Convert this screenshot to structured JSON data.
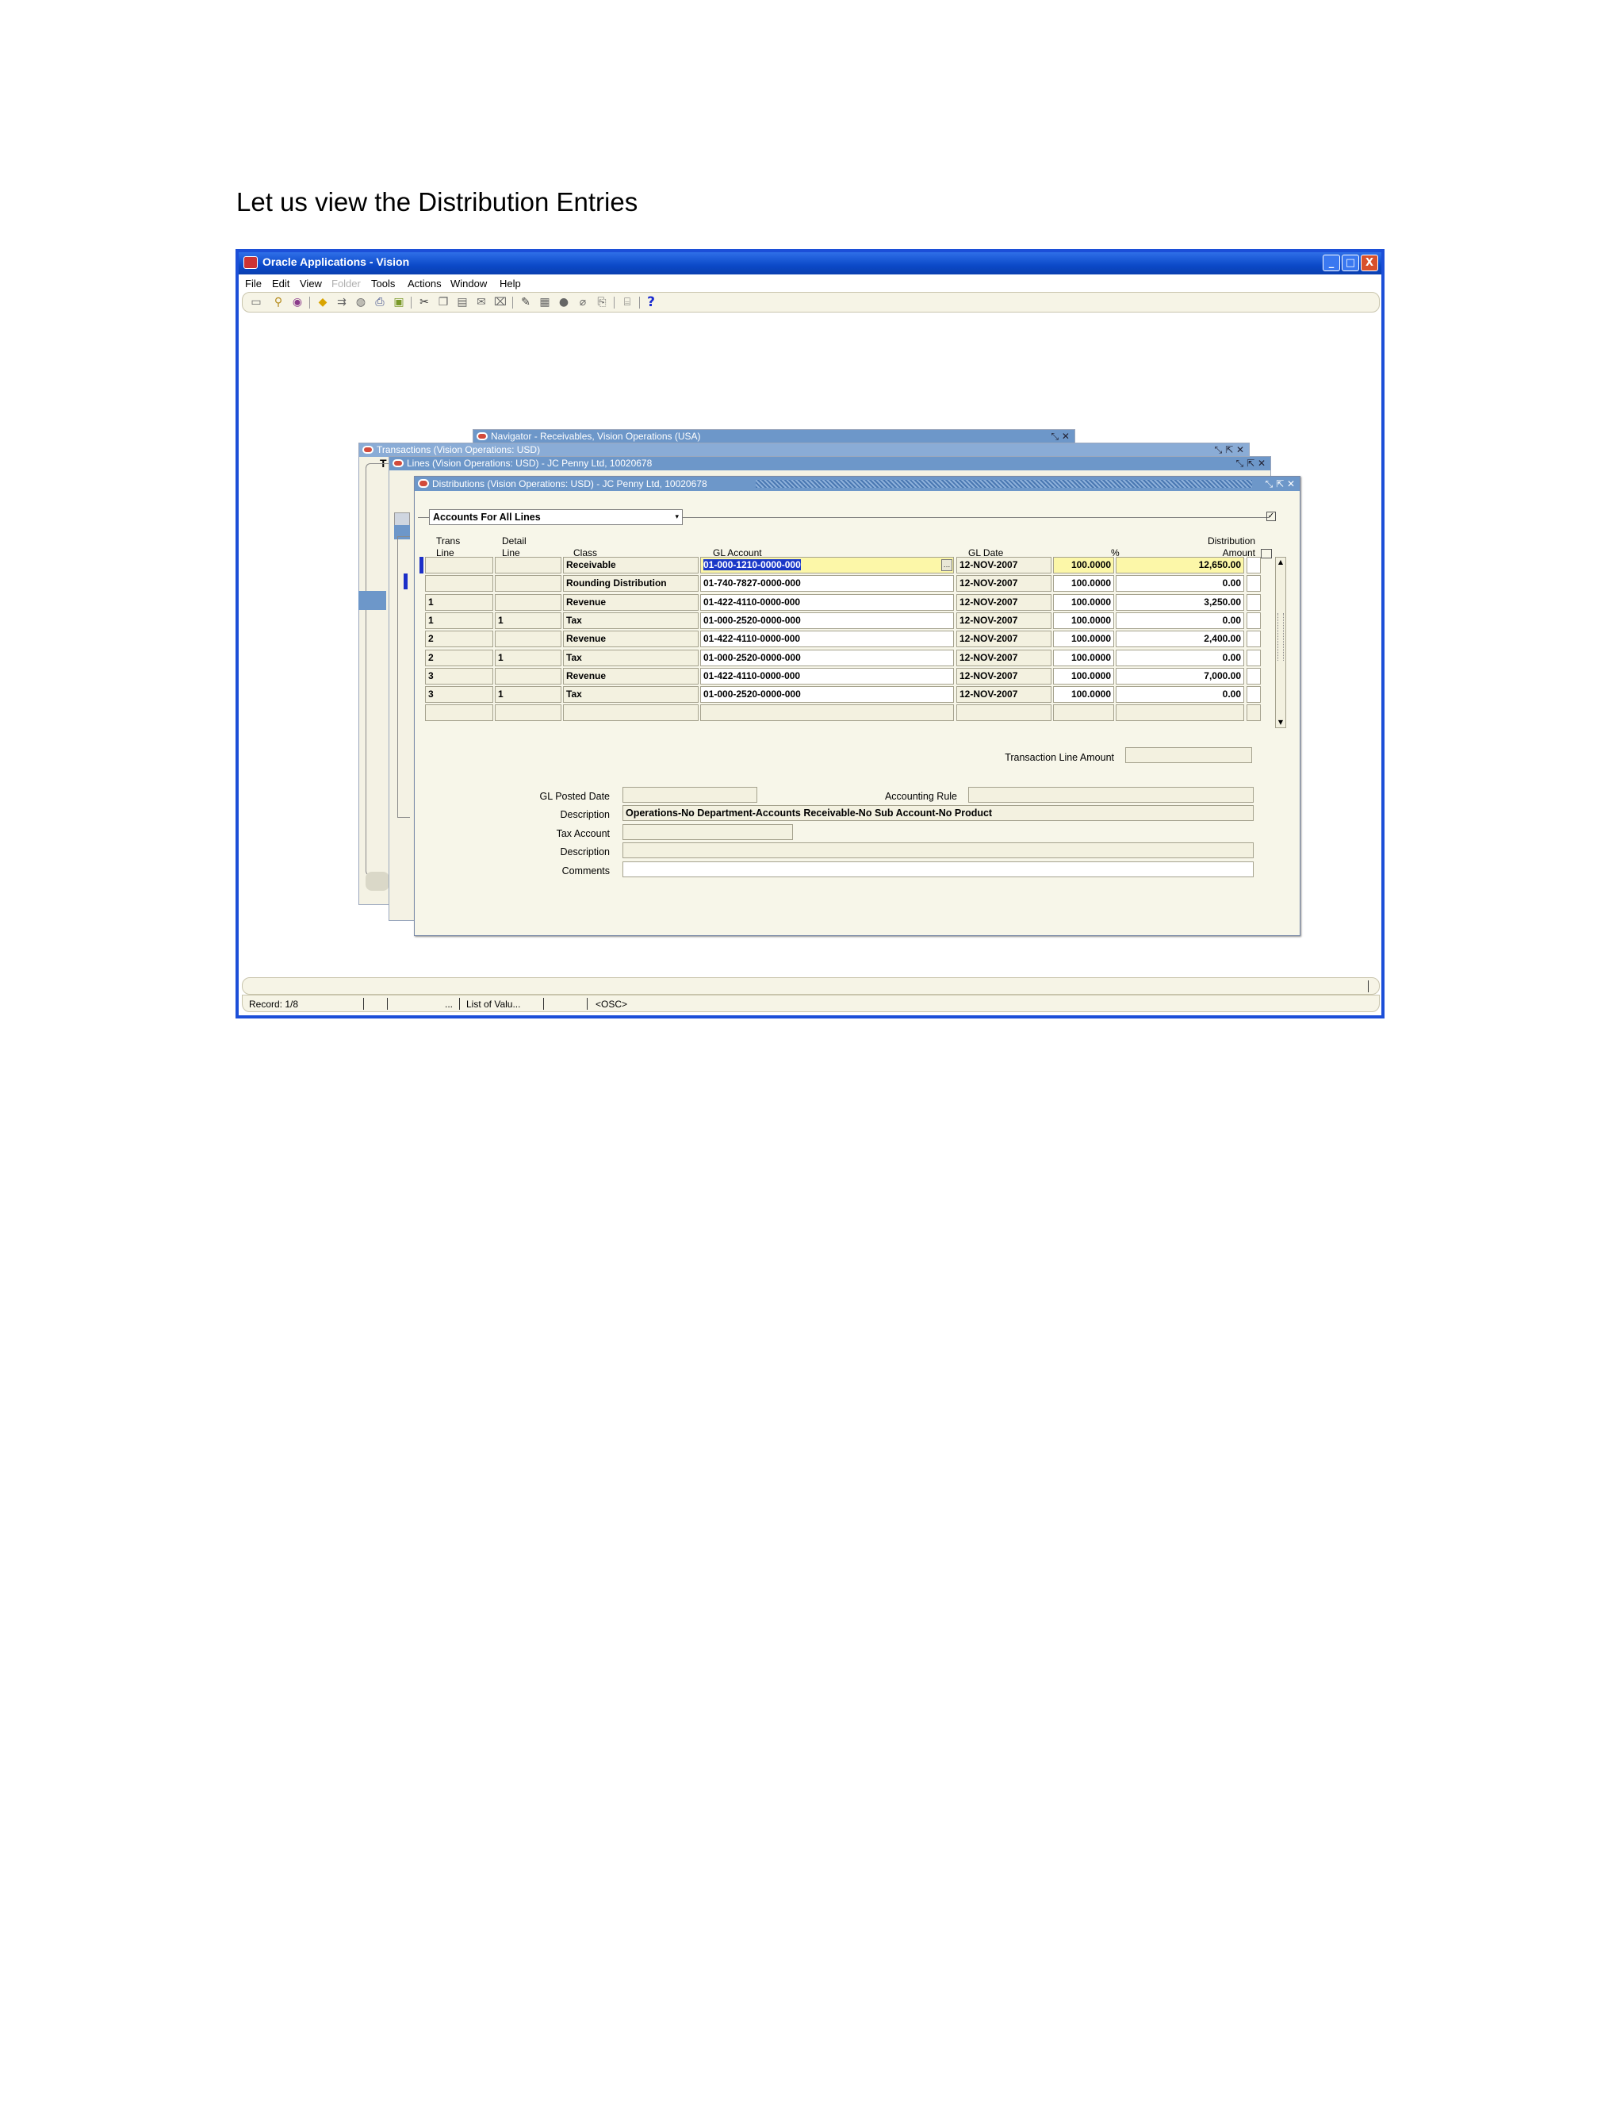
{
  "caption": "Let us view the Distribution Entries",
  "app": {
    "title": "Oracle Applications - Vision",
    "window_buttons": [
      "_",
      "□",
      "X"
    ]
  },
  "menu": [
    {
      "label": "File",
      "enabled": true
    },
    {
      "label": "Edit",
      "enabled": true
    },
    {
      "label": "View",
      "enabled": true
    },
    {
      "label": "Folder",
      "enabled": false
    },
    {
      "label": "Tools",
      "enabled": true
    },
    {
      "label": "Actions",
      "enabled": true
    },
    {
      "label": "Window",
      "enabled": true
    },
    {
      "label": "Help",
      "enabled": true
    }
  ],
  "toolbar": {
    "help_glyph": "?"
  },
  "background_windows": {
    "navigator": "Navigator - Receivables, Vision Operations (USA)",
    "transactions": "Transactions (Vision Operations: USD)",
    "transactions_stub": "T",
    "lines": "Lines (Vision Operations: USD) - JC Penny Ltd, 10020678"
  },
  "distributions": {
    "title": "Distributions (Vision Operations: USD) - JC Penny Ltd, 10020678",
    "view_selector": "Accounts For All Lines",
    "columns": {
      "trans_line_1": "Trans",
      "trans_line_2": "Line",
      "detail_line_1": "Detail",
      "detail_line_2": "Line",
      "class": "Class",
      "gl_account": "GL Account",
      "gl_date": "GL Date",
      "percent": "%",
      "amount_1": "Distribution",
      "amount_2": "Amount"
    },
    "rows": [
      {
        "trans_line": "",
        "detail_line": "",
        "class": "Receivable",
        "gl_account": "01-000-1210-0000-000",
        "gl_date": "12-NOV-2007",
        "percent": "100.0000",
        "amount": "12,650.00"
      },
      {
        "trans_line": "",
        "detail_line": "",
        "class": "Rounding Distribution",
        "gl_account": "01-740-7827-0000-000",
        "gl_date": "12-NOV-2007",
        "percent": "100.0000",
        "amount": "0.00"
      },
      {
        "trans_line": "1",
        "detail_line": "",
        "class": "Revenue",
        "gl_account": "01-422-4110-0000-000",
        "gl_date": "12-NOV-2007",
        "percent": "100.0000",
        "amount": "3,250.00"
      },
      {
        "trans_line": "1",
        "detail_line": "1",
        "class": "Tax",
        "gl_account": "01-000-2520-0000-000",
        "gl_date": "12-NOV-2007",
        "percent": "100.0000",
        "amount": "0.00"
      },
      {
        "trans_line": "2",
        "detail_line": "",
        "class": "Revenue",
        "gl_account": "01-422-4110-0000-000",
        "gl_date": "12-NOV-2007",
        "percent": "100.0000",
        "amount": "2,400.00"
      },
      {
        "trans_line": "2",
        "detail_line": "1",
        "class": "Tax",
        "gl_account": "01-000-2520-0000-000",
        "gl_date": "12-NOV-2007",
        "percent": "100.0000",
        "amount": "0.00"
      },
      {
        "trans_line": "3",
        "detail_line": "",
        "class": "Revenue",
        "gl_account": "01-422-4110-0000-000",
        "gl_date": "12-NOV-2007",
        "percent": "100.0000",
        "amount": "7,000.00"
      },
      {
        "trans_line": "3",
        "detail_line": "1",
        "class": "Tax",
        "gl_account": "01-000-2520-0000-000",
        "gl_date": "12-NOV-2007",
        "percent": "100.0000",
        "amount": "0.00"
      }
    ],
    "labels": {
      "transaction_line_amount": "Transaction Line Amount",
      "gl_posted_date": "GL Posted Date",
      "accounting_rule": "Accounting Rule",
      "description": "Description",
      "tax_account": "Tax Account",
      "tax_description": "Description",
      "comments": "Comments"
    },
    "values": {
      "transaction_line_amount": "",
      "gl_posted_date": "",
      "accounting_rule": "",
      "description": "Operations-No Department-Accounts Receivable-No Sub Account-No Product",
      "tax_account": "",
      "tax_description": "",
      "comments": ""
    }
  },
  "status": {
    "record": "Record: 1/8",
    "ellipsis": "...",
    "list_of_values": "List of Valu...",
    "osc": "<OSC>"
  }
}
